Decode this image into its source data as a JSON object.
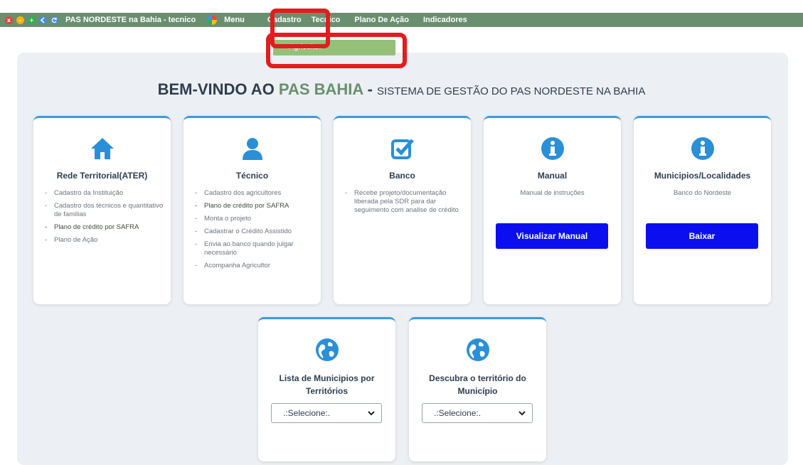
{
  "window": {
    "title": "PAS NORDESTE na Bahia - tecnico",
    "controls": [
      "x",
      "-",
      "+"
    ]
  },
  "menubar": {
    "items": [
      {
        "label": "Menu"
      },
      {
        "label": "Cadastro"
      },
      {
        "label": "Tecnico"
      },
      {
        "label": "Plano De Ação"
      },
      {
        "label": "Indicadores"
      }
    ]
  },
  "dropdown": {
    "items": [
      {
        "label": "Agricultor"
      }
    ]
  },
  "heading": {
    "part1": "BEM-VINDO AO ",
    "part2": "PAS BAHIA",
    "part3": " - ",
    "part4": "SISTEMA DE GESTÃO DO PAS NORDESTE NA BAHIA"
  },
  "cards": [
    {
      "title": "Rede Territorial(ATER)",
      "icon": "home-icon",
      "items": [
        "Cadastro da Instituição",
        "Cadastro dos técnicos e quantitativo de familias",
        "Plano de crédito por SAFRA",
        "Plano de Ação"
      ]
    },
    {
      "title": "Técnico",
      "icon": "user-icon",
      "items": [
        "Cadastro dos agricultores",
        "Plano de crédito por SAFRA",
        "Monta o projeto",
        "Cadastrar o Crédito Assistido",
        "Envia ao banco quando julgar necessário",
        "Acompanha Agricultor"
      ]
    },
    {
      "title": "Banco",
      "icon": "check-square-icon",
      "items": [
        "Recebe projeto/documentação liberada pela SDR para dar seguimento com analise de crédito"
      ]
    },
    {
      "title": "Manual",
      "icon": "info-icon",
      "desc": "Manual de instruções",
      "button": "Visualizar Manual"
    },
    {
      "title": "Municipios/Localidades",
      "icon": "info-icon",
      "desc": "Banco do Nordeste",
      "button": "Baixar"
    }
  ],
  "lower_cards": [
    {
      "title_line1": "Lista de Municipios por",
      "title_line2": "Territórios",
      "icon": "globe-icon",
      "select_value": ".:Selecione:."
    },
    {
      "title_line1": "Descubra o território do",
      "title_line2": "Município",
      "icon": "globe-icon",
      "select_value": ".:Selecione:."
    }
  ],
  "colors": {
    "menubar": "#6a8f6f",
    "dropdown": "#94c07a",
    "accent_blue": "#3a9be0",
    "button_blue": "#0b0ff0",
    "annotation_red": "#e11d1d"
  }
}
